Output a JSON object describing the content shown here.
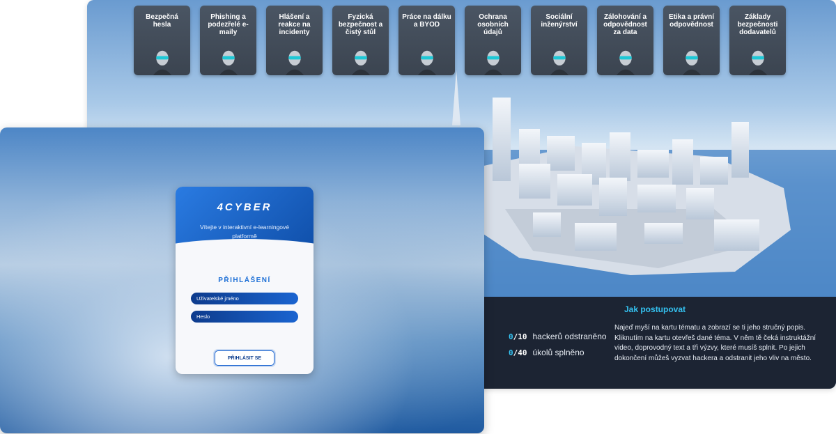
{
  "topics": [
    {
      "title": "Bezpečná hesla",
      "avatar_color": "#1ec8d6"
    },
    {
      "title": "Phishing a podezřelé e-maily",
      "avatar_color": "#1ec8d6"
    },
    {
      "title": "Hlášení a reakce na incidenty",
      "avatar_color": "#1ec8d6"
    },
    {
      "title": "Fyzická bezpečnost a čistý stůl",
      "avatar_color": "#1ec8d6"
    },
    {
      "title": "Práce na dálku a BYOD",
      "avatar_color": "#1ec8d6"
    },
    {
      "title": "Ochrana osobních údajů",
      "avatar_color": "#1ec8d6"
    },
    {
      "title": "Sociální inženýrství",
      "avatar_color": "#1ec8d6"
    },
    {
      "title": "Zálohování a odpovědnost za data",
      "avatar_color": "#1ec8d6"
    },
    {
      "title": "Etika a právní odpovědnost",
      "avatar_color": "#1ec8d6"
    },
    {
      "title": "Základy bezpečnosti dodavatelů",
      "avatar_color": "#1ec8d6"
    }
  ],
  "progress": {
    "hackers": {
      "done": "0",
      "total": "/10",
      "label": "hackerů odstraněno"
    },
    "tasks": {
      "done": "0",
      "total": "/40",
      "label": "úkolů splněno"
    }
  },
  "howto": {
    "title": "Jak postupovat",
    "text": "Najeď myší na kartu tématu a zobrazí se ti jeho stručný popis. Kliknutím na kartu otevřeš dané téma. V něm tě čeká instruktážní video, doprovodný text a tři výzvy, které musíš splnit. Po jejich dokončení můžeš vyzvat hackera a odstranit jeho vliv na město."
  },
  "login": {
    "brand": "4CYBER",
    "welcome": "Vítejte v interaktivní e-learningové platformě",
    "title": "PŘIHLÁŠENÍ",
    "username_placeholder": "Uživatelské jméno",
    "password_placeholder": "Heslo",
    "submit_label": "PŘIHLÁSIT SE"
  },
  "colors": {
    "accent": "#34c3f2",
    "brand_blue": "#1a64d0",
    "panel_dark": "#1c2433",
    "card_bg": "#434d5a"
  }
}
